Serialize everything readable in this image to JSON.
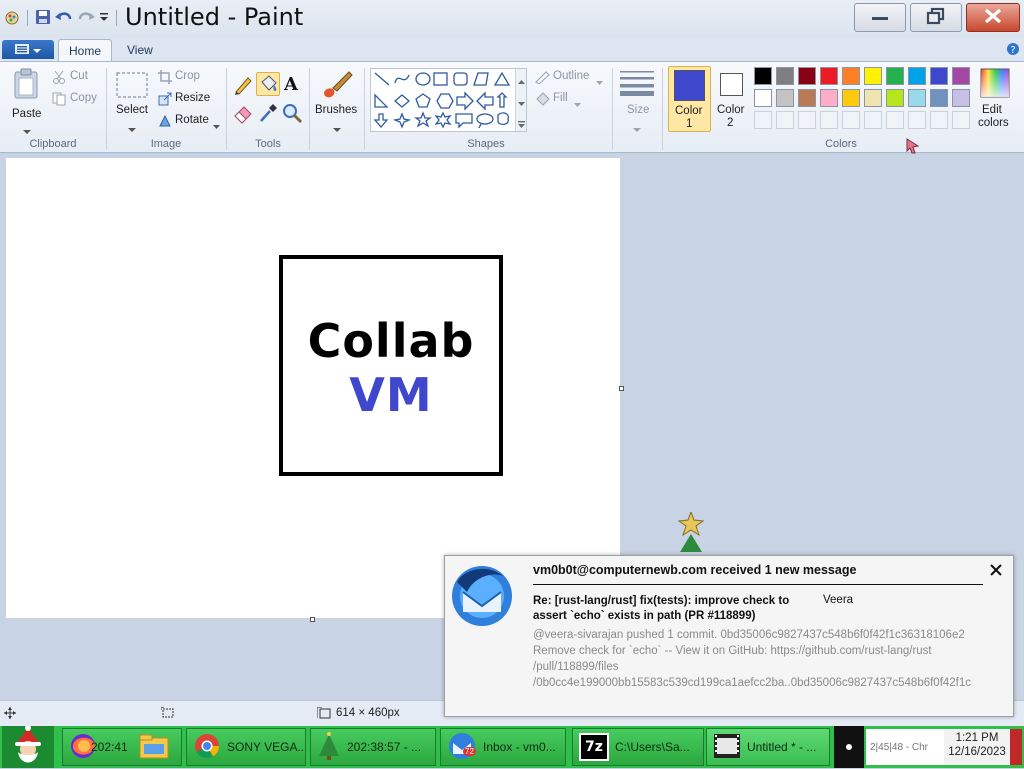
{
  "app": {
    "title": "Untitled - Paint",
    "tabs": [
      "Home",
      "View"
    ]
  },
  "clipboard": {
    "paste": "Paste",
    "cut": "Cut",
    "copy": "Copy",
    "group": "Clipboard"
  },
  "image": {
    "select": "Select",
    "crop": "Crop",
    "resize": "Resize",
    "rotate": "Rotate",
    "group": "Image"
  },
  "tools": {
    "group": "Tools",
    "text_tool": "A"
  },
  "brushes": {
    "label": "Brushes"
  },
  "shapes": {
    "outline": "Outline",
    "fill": "Fill",
    "group": "Shapes"
  },
  "size": {
    "label": "Size"
  },
  "colors": {
    "color1_label": "Color",
    "color1_num": "1",
    "color2_label": "Color",
    "color2_num": "2",
    "group": "Colors",
    "edit_label": "Edit",
    "edit_label2": "colors",
    "color1": "#3f48cc",
    "color2": "#ffffff",
    "palette_row1": [
      "#000000",
      "#7f7f7f",
      "#880015",
      "#ed1c24",
      "#ff7f27",
      "#fff200",
      "#22b14c",
      "#00a2e8",
      "#3f48cc",
      "#a349a4"
    ],
    "palette_row2": [
      "#ffffff",
      "#c3c3c3",
      "#b97a57",
      "#ffaec9",
      "#ffc90e",
      "#efe4b0",
      "#b5e61d",
      "#99d9ea",
      "#7092be",
      "#c8bfe7"
    ]
  },
  "canvas_art": {
    "line1": "Collab",
    "line2": "VM",
    "line2_color": "#3f48cc"
  },
  "status": {
    "canvas_size": "614 × 460px"
  },
  "notification": {
    "header": "vm0b0t@computernewb.com received 1 new message",
    "subject": "Re: [rust-lang/rust] fix(tests): improve check to assert `echo` exists in path (PR #118899)",
    "sender": "Veera",
    "body_line1": "@veera-sivarajan pushed 1 commit. 0bd35006c9827437c548b6f0f42f1c36318106e2",
    "body_line2": "Remove check for `echo` -- View it on GitHub: https://github.com/rust-lang/rust",
    "body_line3": "/pull/118899/files",
    "body_line4": "/0b0cc4e199000bb15583c539cd199ca1aefcc2ba..0bd35006c9827437c548b6f0f42f1c"
  },
  "taskbar": {
    "firefox": "202:41",
    "chrome": "SONY VEGA...",
    "tree": "202:38:57 - ...",
    "thunderbird": "Inbox - vm0...",
    "thunderbird_badge": "72",
    "sevenzip": "C:\\Users\\Sa...",
    "paint": "Untitled * - ...",
    "tray_text": "2|45|48 - Chr",
    "time": "1:21 PM",
    "date": "12/16/2023"
  }
}
